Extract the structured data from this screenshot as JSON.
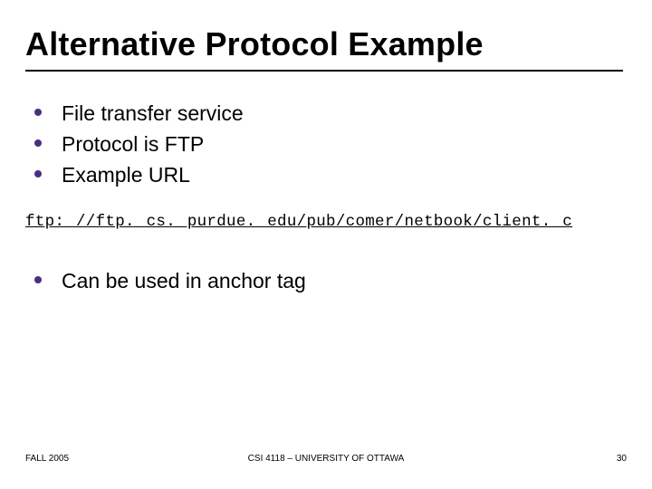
{
  "title": "Alternative Protocol Example",
  "bullets_a": [
    "File transfer service",
    "Protocol is FTP",
    "Example URL"
  ],
  "url": "ftp: //ftp. cs. purdue. edu/pub/comer/netbook/client. c",
  "bullets_b": [
    "Can be used in anchor tag"
  ],
  "footer": {
    "left": "FALL 2005",
    "center": "CSI 4118 – UNIVERSITY OF OTTAWA",
    "right": "30"
  }
}
